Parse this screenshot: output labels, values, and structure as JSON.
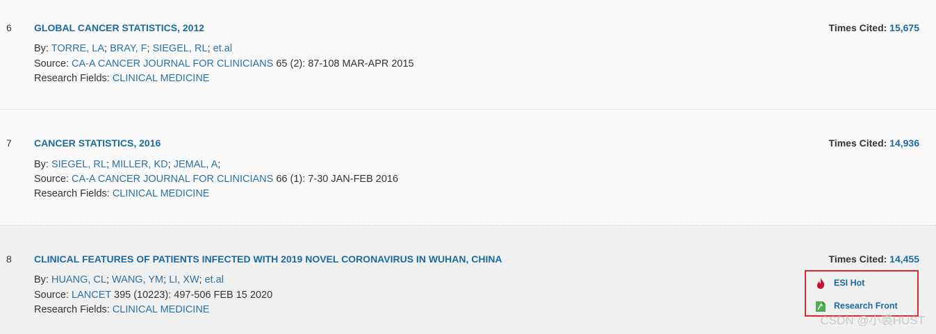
{
  "results": [
    {
      "number": "6",
      "title": "GLOBAL CANCER STATISTICS, 2012",
      "by_label": "By:",
      "authors": [
        "TORRE, LA",
        "BRAY, F",
        "SIEGEL, RL",
        "et.al"
      ],
      "source_label": "Source:",
      "journal": "CA-A CANCER JOURNAL FOR CLINICIANS",
      "source_detail": "65 (2): 87-108 MAR-APR 2015",
      "fields_label": "Research Fields:",
      "field": "CLINICAL MEDICINE",
      "cited_label": "Times Cited:",
      "cited_value": "15,675"
    },
    {
      "number": "7",
      "title": "CANCER STATISTICS, 2016",
      "by_label": "By:",
      "authors": [
        "SIEGEL, RL",
        "MILLER, KD",
        "JEMAL, A"
      ],
      "source_label": "Source:",
      "journal": "CA-A CANCER JOURNAL FOR CLINICIANS",
      "source_detail": "66 (1): 7-30 JAN-FEB 2016",
      "fields_label": "Research Fields:",
      "field": "CLINICAL MEDICINE",
      "cited_label": "Times Cited:",
      "cited_value": "14,936"
    },
    {
      "number": "8",
      "title": "CLINICAL FEATURES OF PATIENTS INFECTED WITH 2019 NOVEL CORONAVIRUS IN WUHAN, CHINA",
      "by_label": "By:",
      "authors": [
        "HUANG, CL",
        "WANG, YM",
        "LI, XW",
        "et.al"
      ],
      "source_label": "Source:",
      "journal": "LANCET",
      "source_detail": "395 (10223): 497-506 FEB 15 2020",
      "fields_label": "Research Fields:",
      "field": "CLINICAL MEDICINE",
      "cited_label": "Times Cited:",
      "cited_value": "14,455",
      "badges": [
        {
          "label": "ESI Hot",
          "icon": "flame-icon",
          "color": "#c8102e"
        },
        {
          "label": "Research Front",
          "icon": "research-front-icon",
          "color": "#4caf50"
        }
      ]
    }
  ],
  "watermark": "CSDN @小裘HUST"
}
